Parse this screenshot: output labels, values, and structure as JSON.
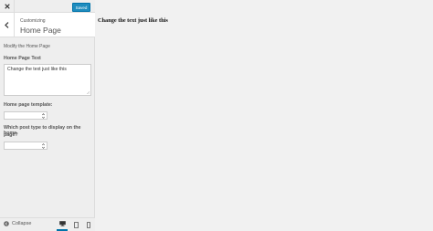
{
  "topbar": {
    "save_label": "Saved"
  },
  "section": {
    "sub_label": "Customizing",
    "title": "Home Page"
  },
  "description": "Modify the Home Page",
  "fields": {
    "home_text_label": "Home Page Text",
    "home_text_value": "Change the text just like this",
    "template_label": "Home page template:",
    "template_value": "",
    "post_type_label_line1": "Which post type to display on the home",
    "post_type_label_line2": "page?",
    "post_type_value": ""
  },
  "footer": {
    "collapse_label": "Collapse",
    "devices": [
      "desktop",
      "tablet",
      "mobile"
    ],
    "active_device": "desktop"
  },
  "preview": {
    "text": "Change the text just like this"
  },
  "colors": {
    "accent": "#0073aa",
    "save_button": "#1e8cbe"
  }
}
